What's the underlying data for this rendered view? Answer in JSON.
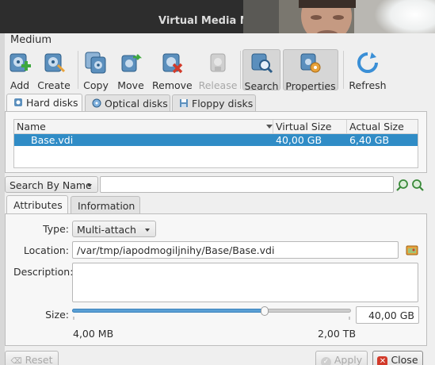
{
  "window": {
    "title": "Virtual Media Ma"
  },
  "menubar": {
    "medium_label": "Medium"
  },
  "toolbar": {
    "add": "Add",
    "create": "Create",
    "copy": "Copy",
    "move": "Move",
    "remove": "Remove",
    "release": "Release",
    "search": "Search",
    "properties": "Properties",
    "refresh": "Refresh"
  },
  "disk_tabs": {
    "hard_disks": "Hard disks",
    "optical_disks": "Optical disks",
    "floppy_disks": "Floppy disks"
  },
  "table": {
    "headers": {
      "name": "Name",
      "virtual_size": "Virtual Size",
      "actual_size": "Actual Size"
    },
    "rows": [
      {
        "name": "Base.vdi",
        "virtual_size": "40,00 GB",
        "actual_size": "6,40 GB"
      }
    ]
  },
  "search": {
    "mode_label": "Search By Name",
    "value": ""
  },
  "attr_tabs": {
    "attributes": "Attributes",
    "information": "Information"
  },
  "attributes": {
    "type_label": "Type:",
    "type_value": "Multi-attach",
    "location_label": "Location:",
    "location_value": "/var/tmp/iapodmogiljnihy/Base/Base.vdi",
    "description_label": "Description:",
    "description_value": "",
    "size_label": "Size:",
    "size_value": "40,00 GB",
    "size_min": "4,00 MB",
    "size_max": "2,00 TB",
    "slider_fraction": 0.69
  },
  "buttons": {
    "reset": "Reset",
    "apply": "Apply",
    "close": "Close"
  },
  "colors": {
    "selection": "#308cc6",
    "accent": "#5a9fd4"
  }
}
